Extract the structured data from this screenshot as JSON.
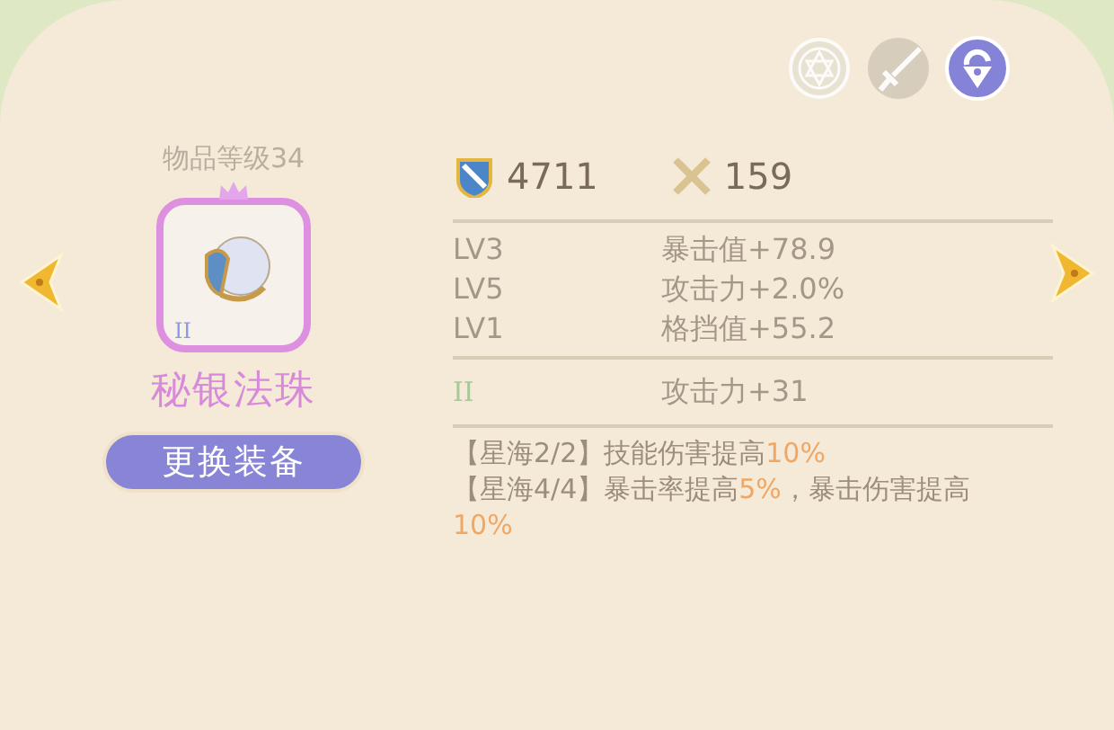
{
  "top_icons": [
    {
      "kind": "star",
      "active": false
    },
    {
      "kind": "sword",
      "active": false
    },
    {
      "kind": "lock",
      "active": true
    }
  ],
  "item": {
    "level_label": "物品等级34",
    "tier": "II",
    "name": "秘银法珠",
    "change_button": "更换装备"
  },
  "power": [
    {
      "kind": "shield",
      "value": "4711"
    },
    {
      "kind": "swords",
      "value": "159"
    }
  ],
  "attributes": [
    {
      "level": "LV3",
      "effect": "暴击值+78.9"
    },
    {
      "level": "LV5",
      "effect": "攻击力+2.0%"
    },
    {
      "level": "LV1",
      "effect": "格挡值+55.2"
    }
  ],
  "tier_bonus": {
    "tier": "II",
    "effect": "攻击力+31"
  },
  "set_bonuses": [
    {
      "segments": [
        {
          "text": "【星海2/2】技能伤害提高",
          "highlight": false
        },
        {
          "text": "10%",
          "highlight": true
        }
      ]
    },
    {
      "segments": [
        {
          "text": "【星海4/4】暴击率提高",
          "highlight": false
        },
        {
          "text": "5%",
          "highlight": true
        },
        {
          "text": "，暴击伤害提高",
          "highlight": false
        },
        {
          "text": "10%",
          "highlight": true
        }
      ]
    }
  ]
}
